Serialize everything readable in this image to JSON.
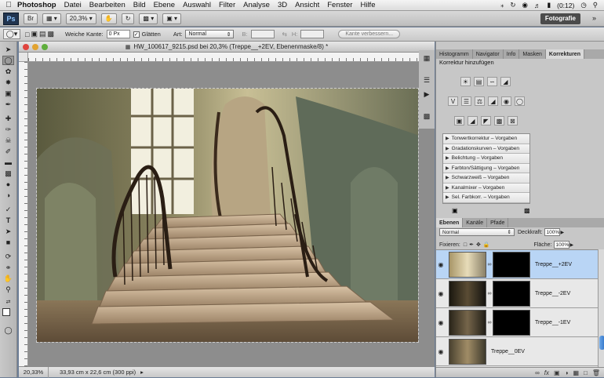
{
  "menubar": {
    "app": "Photoshop",
    "items": [
      "Datei",
      "Bearbeiten",
      "Bild",
      "Ebene",
      "Auswahl",
      "Filter",
      "Analyse",
      "3D",
      "Ansicht",
      "Fenster",
      "Hilfe"
    ],
    "battery": "(0:12)"
  },
  "appbar": {
    "zoom": "20,3%",
    "workspace": "Fotografie"
  },
  "options": {
    "feather_label": "Weiche Kante:",
    "feather_value": "0 Px",
    "antialias_label": "Glätten",
    "style_label": "Art:",
    "style_value": "Normal",
    "width_label": "B:",
    "height_label": "H:",
    "refine_label": "Kante verbessern..."
  },
  "document": {
    "title": "HW_100617_9215.psd bei 20,3% (Treppe__+2EV, Ebenenmaske/8) *",
    "zoom": "20,33%",
    "info": "33,93 cm x 22,6 cm (300 ppi)"
  },
  "panels": {
    "top_tabs": [
      "Histogramm",
      "Navigator",
      "Info",
      "Masken",
      "Korrekturen"
    ],
    "active_top_tab": "Korrekturen",
    "adjust_title": "Korrektur hinzufügen",
    "presets": [
      "Tonwertkorrektur – Vorgaben",
      "Gradationskurven – Vorgaben",
      "Belichtung – Vorgaben",
      "Farbton/Sättigung – Vorgaben",
      "Schwarzweiß – Vorgaben",
      "Kanalmixer – Vorgaben",
      "Sel. Farbkorr. – Vorgaben"
    ],
    "layer_tabs": [
      "Ebenen",
      "Kanäle",
      "Pfade"
    ],
    "active_layer_tab": "Ebenen",
    "blend_mode": "Normal",
    "opacity_label": "Deckkraft:",
    "opacity_value": "100%",
    "lock_label": "Fixieren:",
    "fill_label": "Fläche:",
    "fill_value": "100%",
    "layers": [
      {
        "name": "Treppe__+2EV",
        "selected": true,
        "mask": true
      },
      {
        "name": "Treppe__-2EV",
        "selected": false,
        "mask": true
      },
      {
        "name": "Treppe__-1EV",
        "selected": false,
        "mask": true
      },
      {
        "name": "Treppe__0EV",
        "selected": false,
        "mask": false
      }
    ]
  },
  "colors": {
    "selection": "#b9d5f5",
    "desktop": "#6c7e97"
  }
}
